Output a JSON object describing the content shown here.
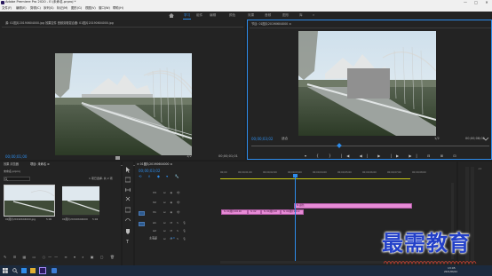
{
  "window": {
    "title": "Adobe Premiere Pro 2020 - E:\\未命名.prproj *",
    "controls": {
      "minimize": "—",
      "maximize": "□",
      "close": "✕"
    }
  },
  "menu": [
    "文件(F)",
    "编辑(E)",
    "剪辑(C)",
    "序列(S)",
    "标记(M)",
    "图形(G)",
    "视图(V)",
    "窗口(W)",
    "帮助(H)"
  ],
  "workspaces": [
    {
      "label": "学习",
      "active": true
    },
    {
      "label": "组件",
      "active": false
    },
    {
      "label": "编辑",
      "active": false
    },
    {
      "label": "颜色",
      "active": false
    },
    {
      "label": "效果",
      "active": false
    },
    {
      "label": "音频",
      "active": false
    },
    {
      "label": "图形",
      "active": false
    },
    {
      "label": "库",
      "active": false
    }
  ],
  "source_monitor": {
    "tab": "源: 01图片20190604000.jpg  效果控件  音频剪辑混合器: 01图片20190604000.jpg",
    "timecode": "00;00;01;00",
    "fit": "适合",
    "ratio": "1/2",
    "duration": "00;00;01;01"
  },
  "program_monitor": {
    "tab": "节目: 01图片20190604000 ≡",
    "timecode": "00;00;03;02",
    "fit": "适合",
    "ratio": "1/2",
    "duration": "00;00;08;02"
  },
  "project_panel": {
    "tabs": [
      "效果 浏览器",
      "项目: 未命名 ≡"
    ],
    "path": "未命名.prproj",
    "count": "1 项已选择, 共 2 项",
    "items": [
      {
        "name": "01图片20190604000.jpg",
        "duration": "5:00"
      },
      {
        "name": "01图片20190604000",
        "duration": "5:02"
      }
    ]
  },
  "timeline": {
    "tab": "× 01图片20190604000 ≡",
    "timecode": "00;00;03;02",
    "ruler": [
      "00;00",
      "00;00;01;00",
      "00;00;02;00",
      "00;00;03;00",
      "00;00;04;00",
      "00;00;05;00",
      "00;00;06;00",
      "00;00;07;00",
      "00;00;08;00"
    ],
    "tracks": [
      {
        "id": "V3"
      },
      {
        "id": "V2"
      },
      {
        "id": "V1"
      },
      {
        "id": "A1"
      },
      {
        "id": "A2"
      },
      {
        "id": "A3"
      }
    ],
    "master": {
      "label": "主声道",
      "value": "0.0"
    },
    "clips_v2": [
      {
        "label": "fx 颜色"
      }
    ],
    "clips_v1": [
      {
        "label": "fx 01图片20190"
      },
      {
        "label": "fx 02"
      },
      {
        "label": "fx 01图片20"
      },
      {
        "label": "fx 01图片2019"
      }
    ]
  },
  "watermark": {
    "text": "最需教育"
  },
  "taskbar": {
    "clock_time": "13:05",
    "clock_date": "2021/06/24"
  },
  "colors": {
    "accent": "#2d8ceb",
    "clip": "#e78bd6",
    "playhead": "#2d8ceb",
    "watermark": "#2340c8"
  }
}
